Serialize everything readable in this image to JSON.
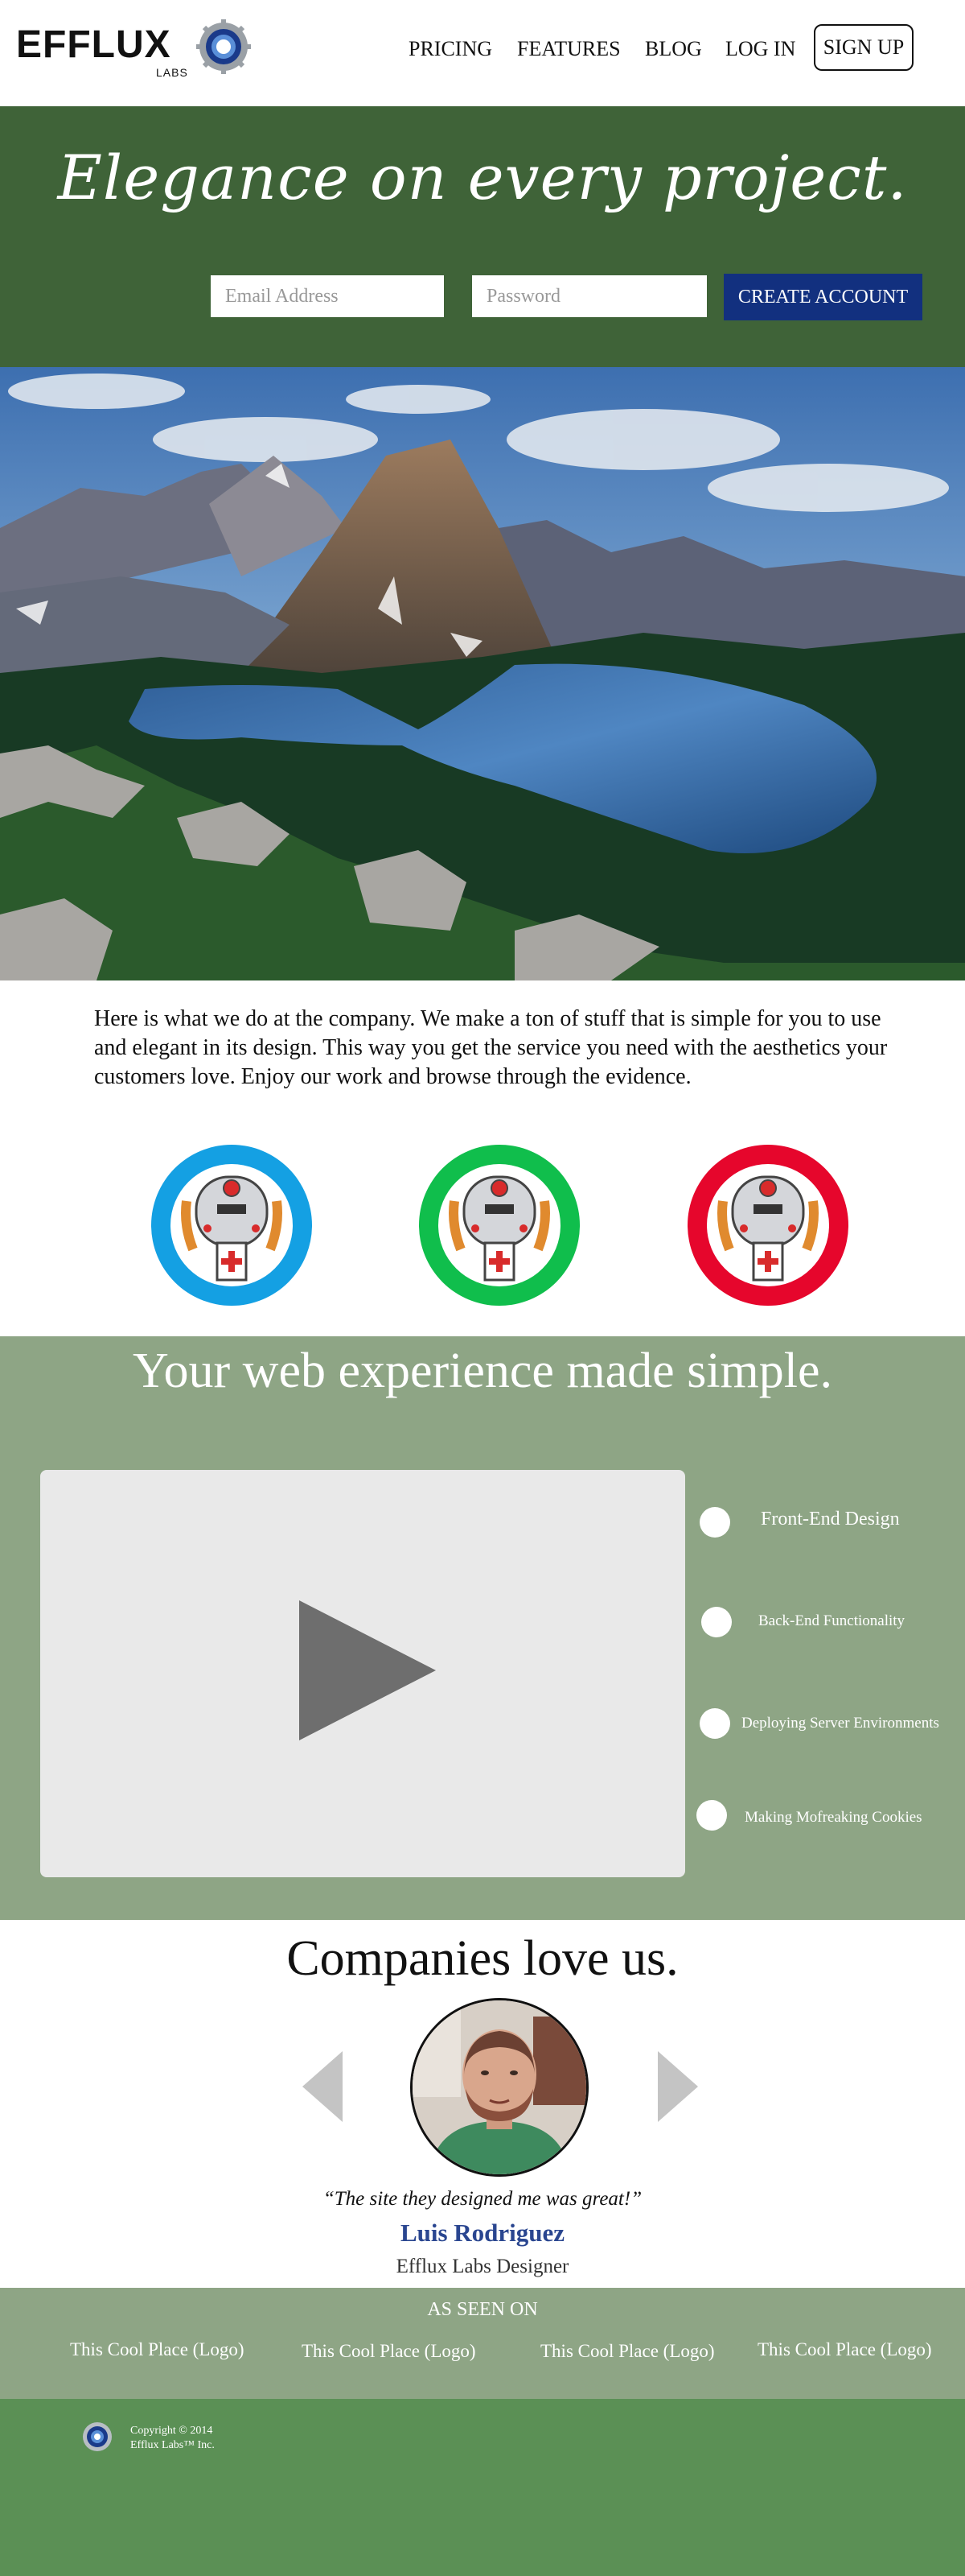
{
  "brand": {
    "name": "EFFLUX",
    "sub": "LABS"
  },
  "nav": {
    "pricing": "PRICING",
    "features": "FEATURES",
    "blog": "BLOG",
    "login": "LOG IN",
    "signup": "SIGN UP"
  },
  "hero": {
    "title": "Elegance on every project.",
    "email_placeholder": "Email Address",
    "password_placeholder": "Password",
    "cta": "CREATE ACCOUNT"
  },
  "intro": {
    "text": "Here is what we do at the company. We make a ton of stuff that is simple for you to use and elegant in its design. This way you get the service you need with the aesthetics your customers love. Enjoy our work and browse through the evidence."
  },
  "robots": {
    "colors": [
      "#14a0e3",
      "#10be4c",
      "#e6062c"
    ]
  },
  "video_section": {
    "title": "Your web experience made simple.",
    "features": [
      "Front-End Design",
      "Back-End Functionality",
      "Deploying Server Environments",
      "Making Mofreaking Cookies"
    ]
  },
  "testimonial": {
    "title": "Companies love us.",
    "quote": "“The site they designed me was great!”",
    "name": "Luis Rodriguez",
    "role": "Efflux Labs Designer"
  },
  "seen_on": {
    "title": "AS SEEN ON",
    "logos": [
      "This Cool Place (Logo)",
      "This Cool Place (Logo)",
      "This Cool Place (Logo)",
      "This Cool Place (Logo)"
    ]
  },
  "footer": {
    "copyright": "Copyright © 2014",
    "company": "Efflux Labs™ Inc."
  },
  "colors": {
    "hero_green": "#3f6338",
    "section_sage": "#8ea585",
    "footer_green": "#5b9055",
    "cta_blue": "#12307f",
    "name_blue": "#2a4690"
  }
}
